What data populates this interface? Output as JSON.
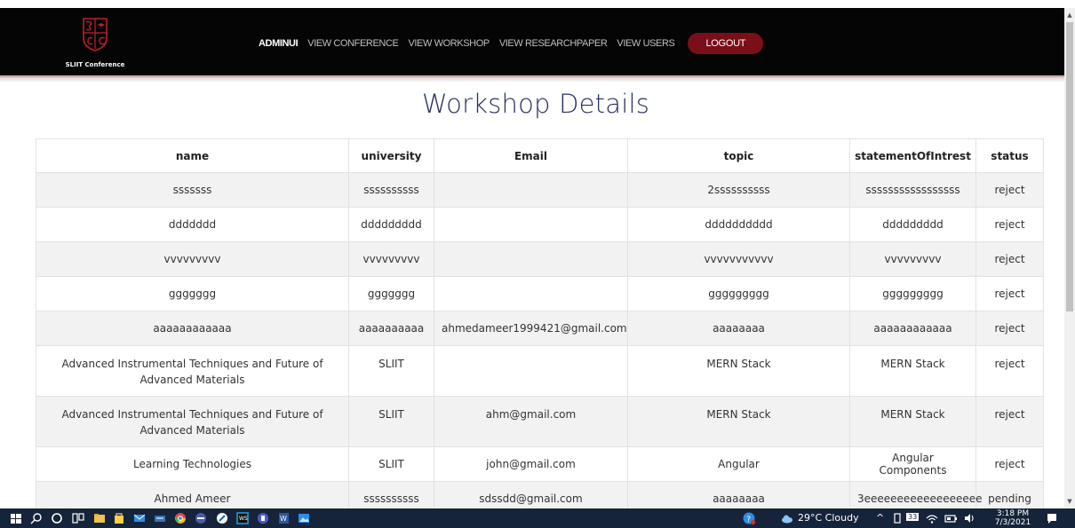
{
  "brand": {
    "logo_text": "SLIIT Conference",
    "accent_color": "#7a0f1a"
  },
  "nav": {
    "links": [
      "ADMINUI",
      "VIEW CONFERENCE",
      "VIEW WORKSHOP",
      "VIEW RESEARCHPAPER",
      "VIEW USERS"
    ],
    "logout_label": "LOGOUT"
  },
  "page": {
    "title": "Workshop Details"
  },
  "table": {
    "columns": [
      "name",
      "university",
      "Email",
      "topic",
      "statementOfIntrest",
      "status"
    ],
    "rows": [
      [
        "sssssss",
        "ssssssssss",
        "",
        "2ssssssssss",
        "sssssssssssssssss",
        "reject"
      ],
      [
        "ddddddd",
        "ddddddddd",
        "",
        "dddddddddd",
        "ddddddddd",
        "reject"
      ],
      [
        "vvvvvvvvv",
        "vvvvvvvvv",
        "",
        "vvvvvvvvvvv",
        "vvvvvvvvv",
        "reject"
      ],
      [
        "ggggggg",
        "ggggggg",
        "",
        "ggggggggg",
        "ggggggggg",
        "reject"
      ],
      [
        "aaaaaaaaaaaa",
        "aaaaaaaaaa",
        "ahmedameer1999421@gmail.com",
        "aaaaaaaa",
        "aaaaaaaaaaaa",
        "reject"
      ],
      [
        "Advanced Instrumental Techniques and Future of Advanced Materials",
        "SLIIT",
        "",
        "MERN Stack",
        "MERN Stack",
        "reject"
      ],
      [
        "Advanced Instrumental Techniques and Future of Advanced Materials",
        "SLIIT",
        "ahm@gmail.com",
        "MERN Stack",
        "MERN Stack",
        "reject"
      ],
      [
        "Learning Technologies",
        "SLIIT",
        "john@gmail.com",
        "Angular",
        "Angular Components",
        "reject"
      ],
      [
        "Ahmed Ameer",
        "ssssssssss",
        "sdssdd@gmail.com",
        "aaaaaaaa",
        "3eeeeeeeeeeeeeeeeee",
        "pending"
      ]
    ]
  },
  "taskbar": {
    "weather": "29°C  Cloudy",
    "notification_count": "33",
    "time": "3:18 PM",
    "date": "7/3/2021"
  }
}
